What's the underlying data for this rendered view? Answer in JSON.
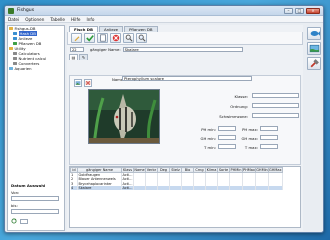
{
  "window": {
    "title": "Fishgus"
  },
  "menu": [
    "Datei",
    "Optionen",
    "Tabelle",
    "Hilfe",
    "Info"
  ],
  "tree": [
    {
      "label": "Fishgus-DB",
      "icon": "folder-icon",
      "depth": 0
    },
    {
      "label": "Hash DB",
      "icon": "fish-icon",
      "depth": 1,
      "selected": true
    },
    {
      "label": "Anlieze",
      "icon": "fish-icon",
      "depth": 1
    },
    {
      "label": "Pflanzen DB",
      "icon": "plant-icon",
      "depth": 1
    },
    {
      "label": "Utility",
      "icon": "folder-icon",
      "depth": 0
    },
    {
      "label": "Calculators",
      "icon": "gear-icon",
      "depth": 1
    },
    {
      "label": "Nutrient calcul",
      "icon": "gear-icon",
      "depth": 1
    },
    {
      "label": "Converters",
      "icon": "gear-icon",
      "depth": 1
    },
    {
      "label": "Aquarien",
      "icon": "bowl-icon",
      "depth": 0
    }
  ],
  "left_bottom": {
    "title": "Datum Auswahl",
    "from_label": "Von:",
    "to_label": "bis:"
  },
  "tabs": [
    "Fisch DB",
    "Anlieze",
    "Pflanzen DB"
  ],
  "search": {
    "id_value": "22",
    "label": "gängiger Name:",
    "value": "Skalare"
  },
  "detail": {
    "name_label": "Name:",
    "name_value": "Pterophyllum scalare",
    "fields": [
      "Klasse:",
      "Ordnung:",
      "Schwimmzone:",
      "PH min:",
      "GH min:",
      "T min:"
    ],
    "fields_right": [
      "PH max:",
      "GH max:",
      "T max:"
    ]
  },
  "grid": {
    "columns": [
      "id",
      "gängiger Name",
      "Klass",
      "Name",
      "Verbr",
      "Deg",
      "Stelz",
      "Bio",
      "Crng",
      "Klima",
      "Sorte",
      "PHMin",
      "PHMax",
      "GHMin",
      "GHMax"
    ],
    "rows": [
      [
        "1",
        "Goldfraugen",
        "Acti..."
      ],
      [
        "2",
        "Blauer Antennenwels",
        "Acti..."
      ],
      [
        "3",
        "Brycehaplocarinter",
        "Acti..."
      ],
      [
        "4",
        "Skalare",
        "Acti..."
      ]
    ]
  }
}
